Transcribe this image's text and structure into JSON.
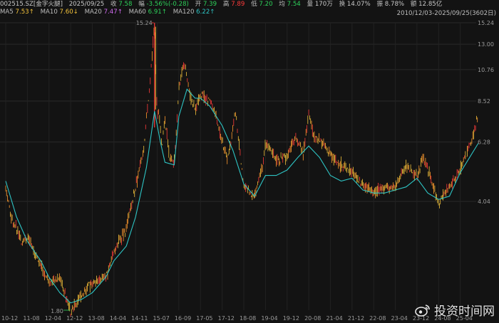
{
  "header": {
    "code": "002515.SZ[金字火腿]",
    "date": "2025/09/25",
    "close_label": "收",
    "close": "7.58",
    "change_label": "幅",
    "change": "-3.56%(-0.28)",
    "open_label": "开",
    "open": "7.39",
    "high_label": "高",
    "high": "7.89",
    "low_label": "低",
    "low": "7.20",
    "avg_label": "均",
    "avg": "7.54",
    "volume_label": "量",
    "volume": "170万",
    "turnover_label": "换",
    "turnover": "14.07%",
    "amplitude_label": "振",
    "amplitude": "8.78%",
    "amount_label": "额",
    "amount": "12.85亿",
    "range": "2010/12/03-2025/09/25(3602日)"
  },
  "ma": {
    "ma5_label": "MA5",
    "ma5": "7.53↑",
    "ma10_label": "MA10",
    "ma10": "7.60↓",
    "ma20_label": "MA20",
    "ma20": "7.47↑",
    "ma60_label": "MA60",
    "ma60": "6.91↑",
    "ma120_label": "MA120",
    "ma120": "6.22↑"
  },
  "colors": {
    "up": "#ff3b3b",
    "down": "#2ed15a",
    "ma5": "#f2c23b",
    "ma120": "#2ec4c4",
    "background": "#131313",
    "grid": "#2a2a2a"
  },
  "watermark": "投资时间网",
  "chart_data": {
    "type": "line",
    "title": "",
    "price_axis": [
      15.24,
      13.0,
      10.76,
      8.52,
      6.28,
      4.04
    ],
    "ylim": [
      1.8,
      15.24
    ],
    "scale": "log",
    "grid": true,
    "x_ticks": [
      "10-12",
      "11-08",
      "12-04",
      "12-12",
      "13-08",
      "14-04",
      "14-11",
      "15-07",
      "16-09",
      "17-05",
      "17-12",
      "18-08",
      "19-04",
      "19-12",
      "20-08",
      "21-04",
      "21-12",
      "22-08",
      "23-04",
      "23-12",
      "24-08",
      "25-04"
    ],
    "annotations": [
      {
        "label": "15.24",
        "x": "15-06",
        "y": 15.24
      },
      {
        "label": "1.80",
        "x": "12-12",
        "y": 1.8
      }
    ],
    "series": [
      {
        "name": "MA120",
        "x": [
          "10-12",
          "11-04",
          "11-08",
          "12-01",
          "12-04",
          "12-08",
          "12-12",
          "13-04",
          "13-08",
          "14-01",
          "14-04",
          "14-08",
          "14-11",
          "15-03",
          "15-06",
          "15-09",
          "15-12",
          "16-06",
          "16-09",
          "16-12",
          "17-03",
          "17-05",
          "17-08",
          "17-12",
          "18-04",
          "18-08",
          "18-12",
          "19-04",
          "19-08",
          "19-12",
          "20-04",
          "20-08",
          "20-12",
          "21-04",
          "21-08",
          "21-12",
          "22-04",
          "22-08",
          "22-12",
          "23-04",
          "23-08",
          "23-12",
          "24-04",
          "24-08",
          "24-12",
          "25-04",
          "25-09"
        ],
        "values": [
          4.7,
          3.6,
          3.0,
          2.6,
          2.3,
          2.05,
          1.9,
          1.95,
          2.05,
          2.3,
          2.6,
          2.9,
          3.6,
          5.2,
          7.9,
          6.3,
          5.4,
          5.3,
          7.6,
          9.3,
          8.7,
          8.7,
          8.2,
          7.1,
          5.9,
          4.6,
          4.2,
          4.9,
          4.9,
          5.1,
          5.6,
          6.1,
          5.6,
          4.9,
          4.7,
          4.8,
          4.4,
          4.3,
          4.3,
          4.4,
          4.5,
          4.8,
          4.3,
          4.1,
          4.2,
          5.0,
          6.22
        ]
      }
    ],
    "price_path": {
      "x": [
        "10-12",
        "11-02",
        "11-06",
        "11-08",
        "11-12",
        "12-04",
        "12-08",
        "12-12",
        "13-04",
        "13-08",
        "14-01",
        "14-04",
        "14-08",
        "14-11",
        "15-02",
        "15-04",
        "15-06",
        "15-07",
        "15-08",
        "15-10",
        "15-12",
        "16-03",
        "16-06",
        "16-09",
        "16-11",
        "17-01",
        "17-03",
        "17-05",
        "17-08",
        "17-10",
        "17-12",
        "18-02",
        "18-05",
        "18-08",
        "18-10",
        "18-12",
        "19-03",
        "19-04",
        "19-08",
        "19-12",
        "20-03",
        "20-06",
        "20-08",
        "20-10",
        "20-12",
        "21-04",
        "21-08",
        "21-12",
        "22-04",
        "22-08",
        "22-12",
        "23-04",
        "23-08",
        "23-12",
        "24-02",
        "24-06",
        "24-08",
        "24-12",
        "25-04",
        "25-07",
        "25-09"
      ],
      "values": [
        4.5,
        3.6,
        3.0,
        3.1,
        2.6,
        2.2,
        2.3,
        1.8,
        2.0,
        2.2,
        2.3,
        2.8,
        3.3,
        4.5,
        6.0,
        9.0,
        15.24,
        7.5,
        8.0,
        6.0,
        7.6,
        5.6,
        5.4,
        9.5,
        11.4,
        9.0,
        8.0,
        9.0,
        8.5,
        7.6,
        6.2,
        5.5,
        7.8,
        4.5,
        4.4,
        4.2,
        5.3,
        6.3,
        5.5,
        5.6,
        6.5,
        5.8,
        7.8,
        6.5,
        6.4,
        5.7,
        5.3,
        5.0,
        4.6,
        4.3,
        4.5,
        4.5,
        5.3,
        4.8,
        5.7,
        4.6,
        4.0,
        4.5,
        5.1,
        6.3,
        7.58
      ]
    }
  }
}
